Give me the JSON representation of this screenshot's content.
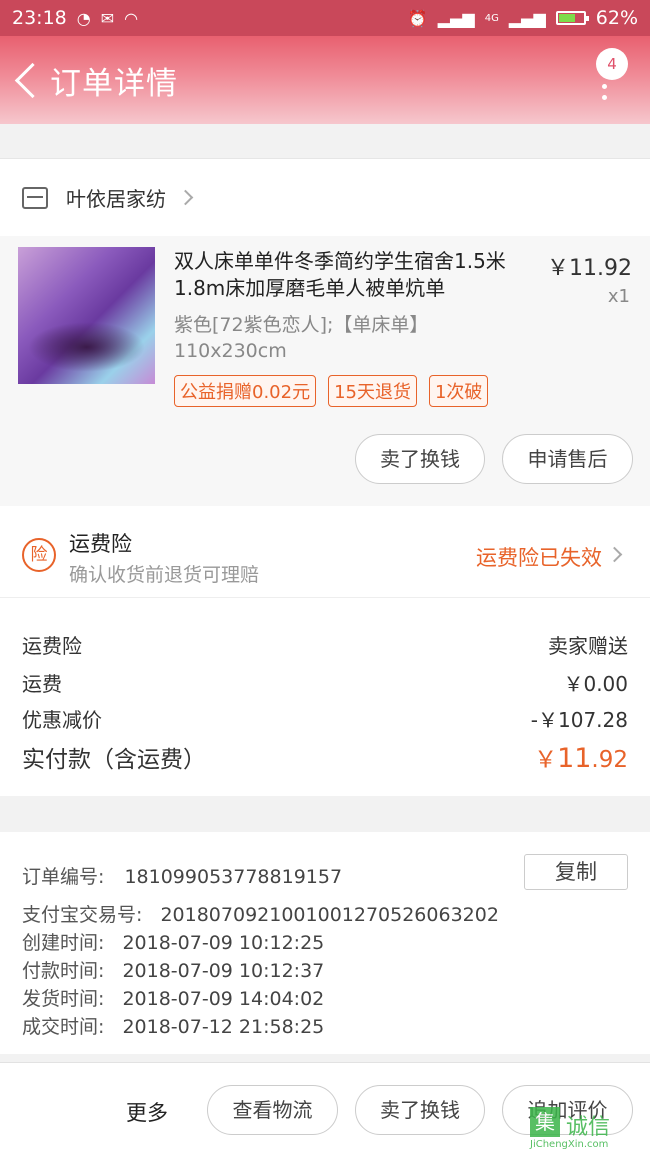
{
  "status_bar": {
    "time": "23:18",
    "signal_label": "4G",
    "battery": "62%",
    "battery_level": 0.62
  },
  "header": {
    "title": "订单详情",
    "badge_count": "4"
  },
  "shop": {
    "name": "叶依居家纺"
  },
  "product": {
    "title": "双人床单单件冬季简约学生宿舍1.5米1.8m床加厚磨毛单人被单炕单",
    "price": "￥11.92",
    "quantity": "x1",
    "spec": "紫色[72紫色恋人];【单床单】110x230cm",
    "tags": [
      "公益捐赠0.02元",
      "15天退货",
      "1次破"
    ],
    "actions": [
      "卖了换钱",
      "申请售后"
    ]
  },
  "insurance": {
    "icon_text": "险",
    "title": "运费险",
    "subtitle": "确认收货前退货可理赔",
    "status": "运费险已失效",
    "accent_color": "#e8632a"
  },
  "fees": {
    "rows": [
      {
        "label": "运费险",
        "value": "卖家赠送"
      },
      {
        "label": "运费",
        "value": "￥0.00"
      },
      {
        "label": "优惠减价",
        "value": "-￥107.28"
      }
    ],
    "total_label": "实付款（含运费）",
    "total_currency": "￥",
    "total_int": "11",
    "total_dec": ".92"
  },
  "order_info": {
    "copy_label": "复制",
    "rows": [
      {
        "label": "订单编号:",
        "value": "181099053778819157"
      },
      {
        "label": "支付宝交易号:",
        "value": "2018070921001001270526063202"
      },
      {
        "label": "创建时间:",
        "value": "2018-07-09 10:12:25"
      },
      {
        "label": "付款时间:",
        "value": "2018-07-09 10:12:37"
      },
      {
        "label": "发货时间:",
        "value": "2018-07-09 14:04:02"
      },
      {
        "label": "成交时间:",
        "value": "2018-07-12 21:58:25"
      }
    ]
  },
  "bottom_bar": {
    "more_label": "更多",
    "buttons": [
      "查看物流",
      "卖了换钱",
      "追加评价"
    ]
  },
  "watermark": {
    "logo_char": "集",
    "text": "诚信",
    "url": "JiChengXin.com"
  }
}
